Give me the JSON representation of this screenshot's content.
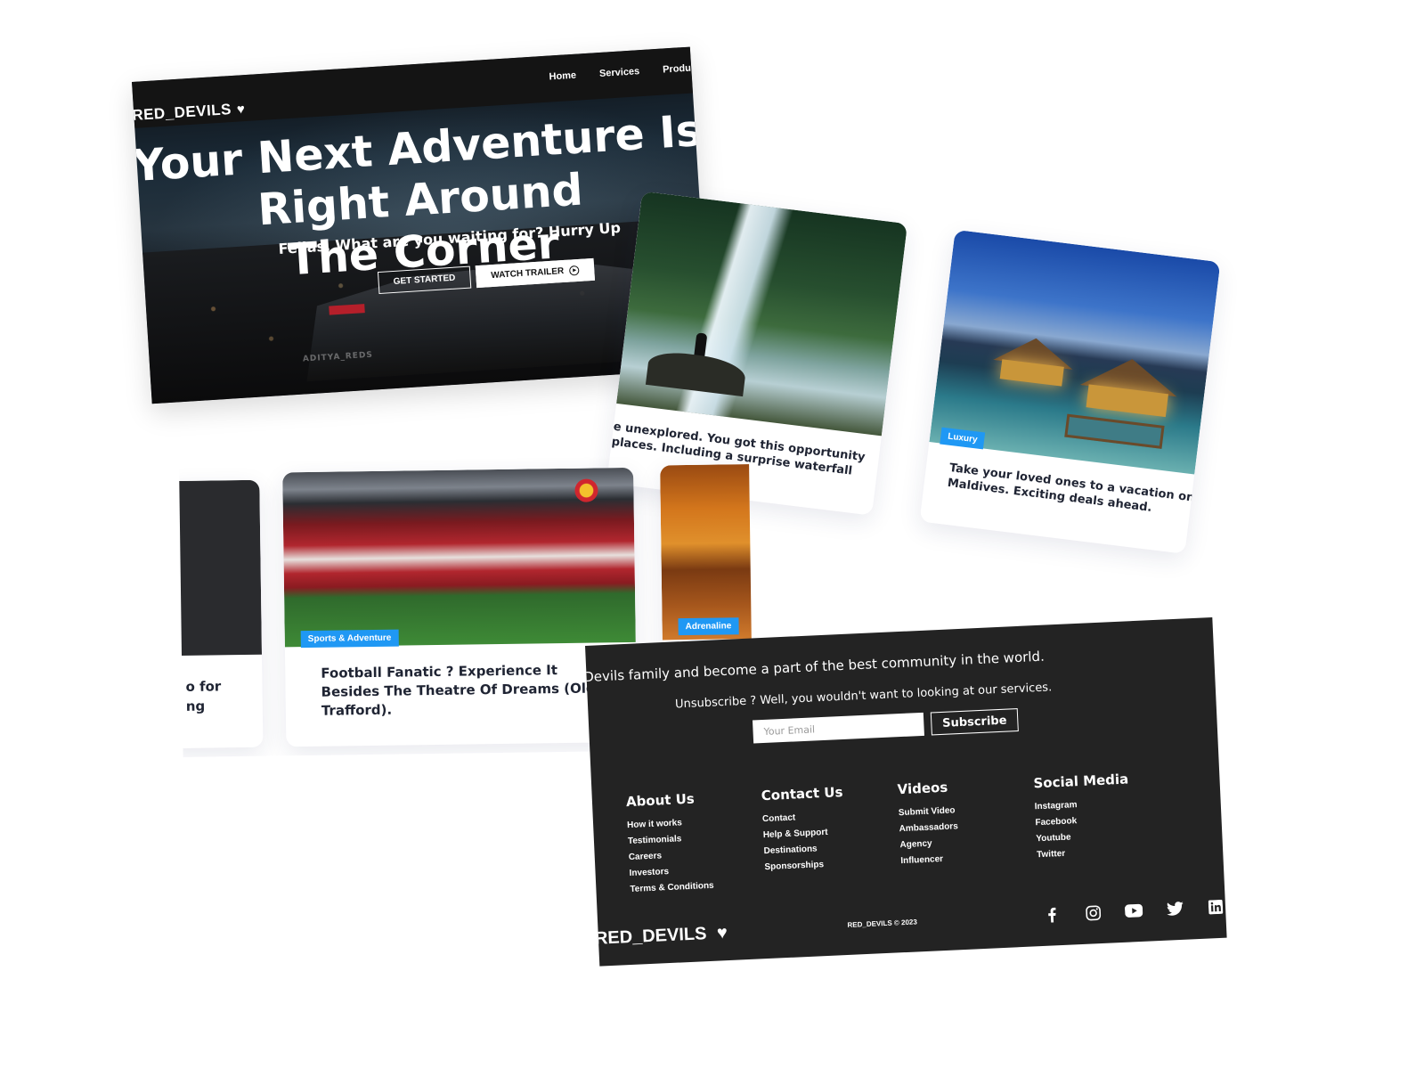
{
  "hero": {
    "brand": "RED_DEVILS",
    "nav": [
      "Home",
      "Services",
      "Produ"
    ],
    "title_line1": "Your Next Adventure Is Right Around",
    "title_line2": "The Corner",
    "subtitle": "Fellas, What are you waiting for? Hurry Up",
    "get_started": "GET STARTED",
    "watch_trailer": "WATCH TRAILER",
    "watermark": "ADITYA_REDS"
  },
  "cards_top": [
    {
      "text": "...e unexplored. You got this opportunity ...places. Including a surprise waterfall",
      "line1": "e unexplored. You got this opportunity",
      "line2": "places. Including a surprise waterfall"
    },
    {
      "tag": "Luxury",
      "line1": "Take your loved ones to a vacation on t",
      "line2": "Maldives. Exciting deals ahead."
    }
  ],
  "cards_mid": [
    {
      "line1": "o for",
      "line2": "ng"
    },
    {
      "tag": "Sports & Adventure",
      "line1": "Football Fanatic ? Experience It",
      "line2": "Besides The Theatre Of Dreams (Old",
      "line3": "Trafford)."
    },
    {
      "tag": "Adrenaline"
    }
  ],
  "footer": {
    "tagline": "Join the Red Devils family and become a part of the best community in the world.",
    "unsubscribe": "Unsubscribe ? Well, you wouldn't want to looking at our services.",
    "email_placeholder": "Your Email",
    "subscribe": "Subscribe",
    "columns": [
      {
        "title": "About Us",
        "links": [
          "How it works",
          "Testimonials",
          "Careers",
          "Investors",
          "Terms & Conditions"
        ]
      },
      {
        "title": "Contact Us",
        "links": [
          "Contact",
          "Help & Support",
          "Destinations",
          "Sponsorships"
        ]
      },
      {
        "title": "Videos",
        "links": [
          "Submit Video",
          "Ambassadors",
          "Agency",
          "Influencer"
        ]
      },
      {
        "title": "Social Media",
        "links": [
          "Instagram",
          "Facebook",
          "Youtube",
          "Twitter"
        ]
      }
    ],
    "brand": "RED_DEVILS",
    "copyright": "RED_DEVILS © 2023",
    "social_icons": [
      "facebook-icon",
      "instagram-icon",
      "youtube-icon",
      "twitter-icon",
      "linkedin-icon"
    ]
  },
  "colors": {
    "tag_blue": "#1f98f4",
    "footer_bg": "#232323",
    "navbar_bg": "#141414",
    "card_text": "#1f2433"
  }
}
